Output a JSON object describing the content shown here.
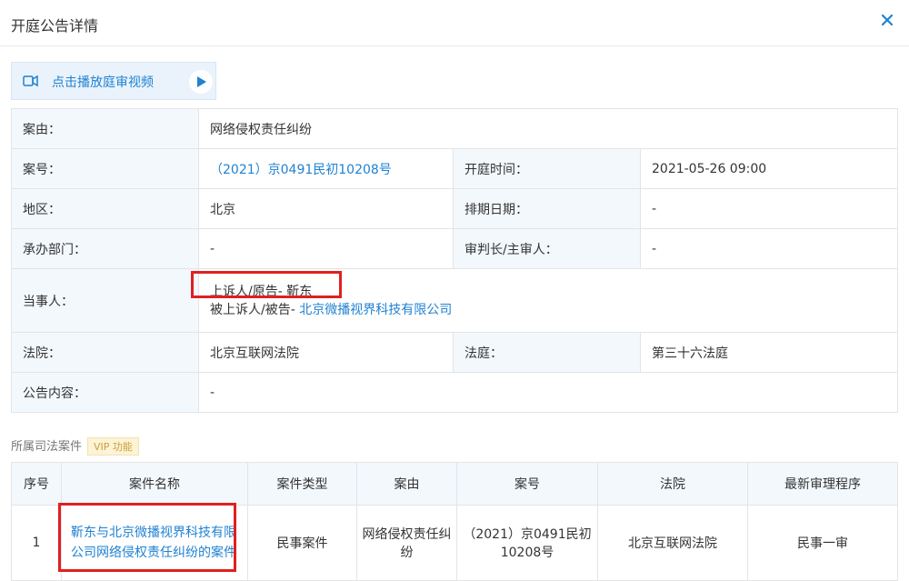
{
  "dialog": {
    "title": "开庭公告详情"
  },
  "video": {
    "label": "点击播放庭审视频"
  },
  "info": {
    "case_cause_label": "案由：",
    "case_cause": "网络侵权责任纠纷",
    "case_no_label": "案号：",
    "case_no": "（2021）京0491民初10208号",
    "hearing_time_label": "开庭时间：",
    "hearing_time": "2021-05-26 09:00",
    "region_label": "地区：",
    "region": "北京",
    "schedule_label": "排期日期：",
    "schedule": "-",
    "dept_label": "承办部门：",
    "dept": "-",
    "judge_label": "审判长/主审人：",
    "judge": "-",
    "parties_label": "当事人：",
    "appellant_prefix": "上诉人/原告- ",
    "appellant": "靳东",
    "appellee_prefix": "被上诉人/被告- ",
    "appellee": "北京微播视界科技有限公司",
    "court_label": "法院：",
    "court": "北京互联网法院",
    "courtroom_label": "法庭：",
    "courtroom": "第三十六法庭",
    "content_label": "公告内容：",
    "content": "-"
  },
  "cases": {
    "section_title": "所属司法案件",
    "vip": "VIP 功能",
    "headers": [
      "序号",
      "案件名称",
      "案件类型",
      "案由",
      "案号",
      "法院",
      "最新审理程序"
    ],
    "rows": [
      {
        "no": "1",
        "name": "靳东与北京微播视界科技有限公司网络侵权责任纠纷的案件",
        "type": "民事案件",
        "cause": "网络侵权责任纠纷",
        "case_no": "（2021）京0491民初10208号",
        "court": "北京互联网法院",
        "stage": "民事一审"
      }
    ]
  }
}
